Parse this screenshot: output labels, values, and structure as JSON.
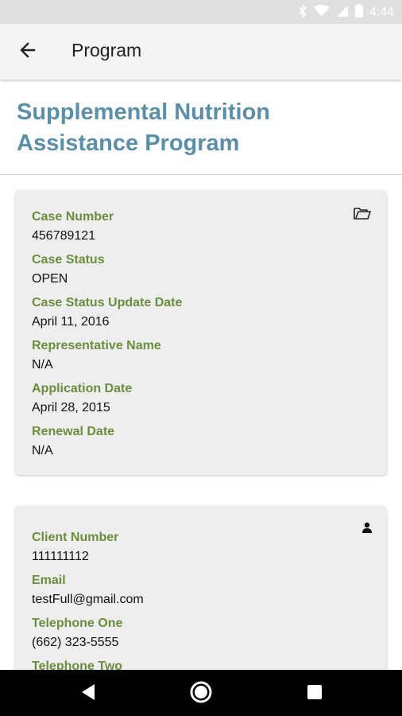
{
  "status_bar": {
    "time": "4:44",
    "icons": [
      "bluetooth-icon",
      "wifi-icon",
      "signal-icon",
      "battery-icon"
    ]
  },
  "app_bar": {
    "title": "Program",
    "back_icon": "arrow-left-icon"
  },
  "program": {
    "title": "Supplemental Nutrition Assistance Program",
    "title_color": "#5b8fa8"
  },
  "case_card": {
    "icon": "folder-open-icon",
    "fields": [
      {
        "label": "Case Number",
        "value": "456789121"
      },
      {
        "label": "Case Status",
        "value": "OPEN"
      },
      {
        "label": "Case Status Update Date",
        "value": "April 11, 2016"
      },
      {
        "label": "Representative Name",
        "value": "N/A"
      },
      {
        "label": "Application Date",
        "value": "April 28, 2015"
      },
      {
        "label": "Renewal Date",
        "value": "N/A"
      }
    ]
  },
  "client_card": {
    "icon": "person-icon",
    "fields": [
      {
        "label": "Client Number",
        "value": "111111112"
      },
      {
        "label": "Email",
        "value": "testFull@gmail.com"
      },
      {
        "label": "Telephone One",
        "value": "(662) 323-5555"
      },
      {
        "label": "Telephone Two"
      }
    ]
  },
  "colors": {
    "label_green": "#6b8e3e",
    "card_bg": "#eeeeee",
    "app_bar_bg": "#f5f5f5"
  },
  "nav_bar": {
    "buttons": [
      "back-triangle-icon",
      "home-circle-icon",
      "recents-square-icon"
    ]
  }
}
